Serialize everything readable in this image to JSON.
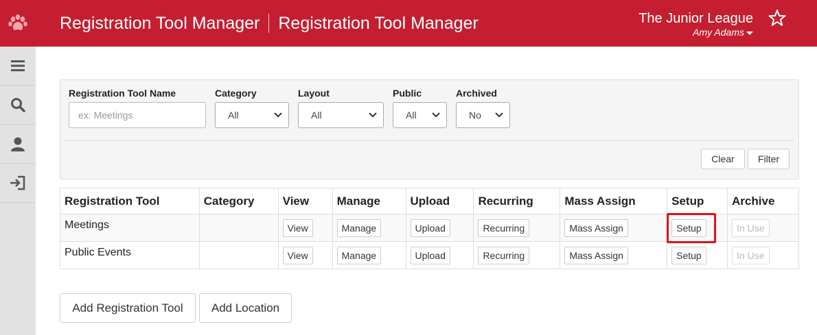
{
  "header": {
    "title": "Registration Tool Manager",
    "subtitle": "Registration Tool Manager",
    "org_name": "The Junior League",
    "user_name": "Amy Adams",
    "brand_color": "#c41e30"
  },
  "sidebar": {
    "items": [
      {
        "icon": "menu-icon"
      },
      {
        "icon": "search-icon"
      },
      {
        "icon": "user-icon"
      },
      {
        "icon": "logout-icon"
      }
    ]
  },
  "filters": {
    "name_label": "Registration Tool Name",
    "name_placeholder": "ex: Meetings",
    "category_label": "Category",
    "category_value": "All",
    "layout_label": "Layout",
    "layout_value": "All",
    "public_label": "Public",
    "public_value": "All",
    "archived_label": "Archived",
    "archived_value": "No",
    "clear_label": "Clear",
    "filter_label": "Filter"
  },
  "table": {
    "headers": [
      "Registration Tool",
      "Category",
      "View",
      "Manage",
      "Upload",
      "Recurring",
      "Mass Assign",
      "Setup",
      "Archive"
    ],
    "rows": [
      {
        "name": "Meetings",
        "category": "",
        "view": "View",
        "manage": "Manage",
        "upload": "Upload",
        "recurring": "Recurring",
        "mass_assign": "Mass Assign",
        "setup": "Setup",
        "archive": "In Use"
      },
      {
        "name": "Public Events",
        "category": "",
        "view": "View",
        "manage": "Manage",
        "upload": "Upload",
        "recurring": "Recurring",
        "mass_assign": "Mass Assign",
        "setup": "Setup",
        "archive": "In Use"
      }
    ]
  },
  "actions": {
    "add_tool_label": "Add Registration Tool",
    "add_location_label": "Add Location"
  }
}
